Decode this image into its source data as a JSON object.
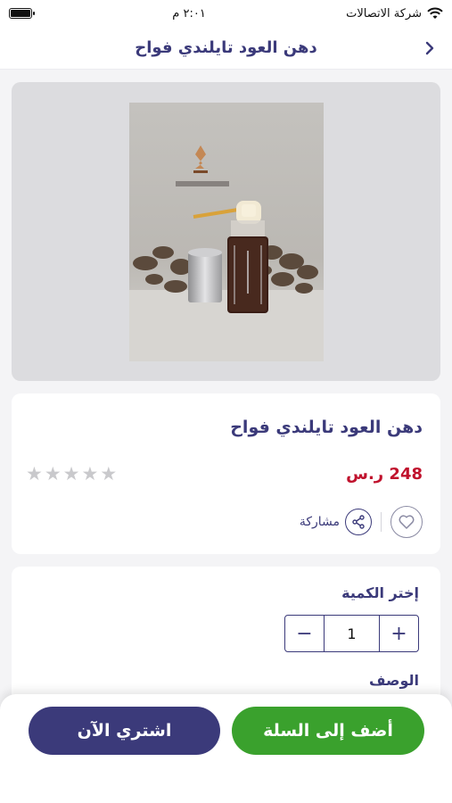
{
  "status_bar": {
    "time": "٢:٠١ م",
    "carrier": "شركة الاتصالات"
  },
  "header": {
    "title": "دهن العود تايلندي فواح",
    "back_icon": "chevron-right-icon"
  },
  "product": {
    "name": "دهن العود تايلندي فواح",
    "price": "248 ر.س",
    "rating_stars": 5,
    "rating_filled": 0,
    "share_label": "مشاركة"
  },
  "quantity": {
    "label": "إختر الكمية",
    "value": "1",
    "minus": "−",
    "plus": "+"
  },
  "description": {
    "title": "الوصف"
  },
  "actions": {
    "add_to_cart": "أضف إلى السلة",
    "buy_now": "اشتري الآن"
  },
  "colors": {
    "primary": "#3b3a7a",
    "price": "#c0122d",
    "cart_button": "#3aa12d"
  }
}
